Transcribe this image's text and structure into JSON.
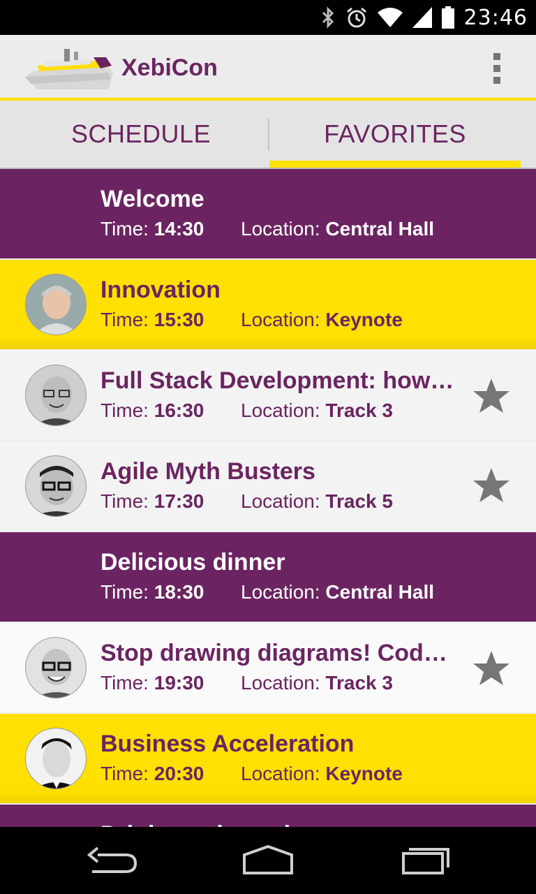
{
  "status_bar": {
    "time": "23:46",
    "icons": [
      "bluetooth-icon",
      "alarm-icon",
      "wifi-icon",
      "signal-icon",
      "battery-icon"
    ]
  },
  "action_bar": {
    "app_title": "XebiCon",
    "logo": "ship-logo",
    "overflow_icon": "overflow-menu-icon"
  },
  "tabs": {
    "schedule": "SCHEDULE",
    "favorites": "FAVORITES",
    "selected": "FAVORITES"
  },
  "labels": {
    "time": "Time:",
    "location": "Location:"
  },
  "sessions": [
    {
      "title": "Welcome",
      "time": "14:30",
      "location": "Central Hall",
      "style": "purple",
      "avatar": false,
      "star": false
    },
    {
      "title": "Innovation",
      "time": "15:30",
      "location": "Keynote",
      "style": "yellow",
      "avatar": true,
      "star": false
    },
    {
      "title": "Full Stack Development: how t…",
      "time": "16:30",
      "location": "Track 3",
      "style": "grey",
      "avatar": true,
      "star": true
    },
    {
      "title": "Agile Myth Busters",
      "time": "17:30",
      "location": "Track 5",
      "style": "grey",
      "avatar": true,
      "star": true
    },
    {
      "title": "Delicious dinner",
      "time": "18:30",
      "location": "Central Hall",
      "style": "purple",
      "avatar": false,
      "star": false
    },
    {
      "title": "Stop drawing diagrams! Code…",
      "time": "19:30",
      "location": "Track 3",
      "style": "white",
      "avatar": true,
      "star": true
    },
    {
      "title": "Business Acceleration",
      "time": "20:30",
      "location": "Keynote",
      "style": "yellow",
      "avatar": true,
      "star": false
    },
    {
      "title": "Drinks and snacks",
      "time": "",
      "location": "",
      "style": "purple",
      "avatar": false,
      "star": false
    }
  ],
  "colors": {
    "purple": "#6b2461",
    "yellow": "#ffe000",
    "star_grey": "#767676"
  },
  "nav_bar": [
    "back-icon",
    "home-icon",
    "recent-apps-icon"
  ]
}
